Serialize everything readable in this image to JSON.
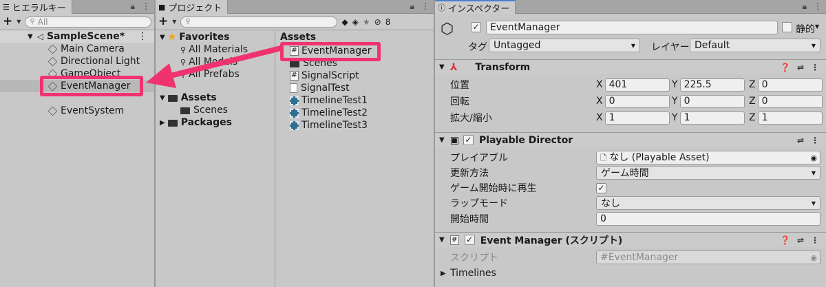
{
  "hierarchy": {
    "tab_label": "ヒエラルキー",
    "search_placeholder": "All",
    "scene": "SampleScene*",
    "items": [
      "Main Camera",
      "Directional Light",
      "GameObject",
      "EventManager",
      "EventSystem"
    ]
  },
  "project": {
    "tab_label": "プロジェクト",
    "hidden_count": "8",
    "favorites": {
      "label": "Favorites",
      "items": [
        "All Materials",
        "All Models",
        "All Prefabs"
      ]
    },
    "tree": {
      "assets": "Assets",
      "scenes": "Scenes",
      "packages": "Packages"
    },
    "assets_header": "Assets",
    "assets_items": [
      "EventManager",
      "Scenes",
      "SignalScript",
      "SignalTest",
      "TimelineTest1",
      "TimelineTest2",
      "TimelineTest3"
    ]
  },
  "inspector": {
    "tab_label": "インスペクター",
    "object_name": "EventManager",
    "static_label": "静的",
    "tag_label": "タグ",
    "tag_value": "Untagged",
    "layer_label": "レイヤー",
    "layer_value": "Default",
    "transform": {
      "title": "Transform",
      "position_label": "位置",
      "position": [
        "401",
        "225.5",
        "0"
      ],
      "rotation_label": "回転",
      "rotation": [
        "0",
        "0",
        "0"
      ],
      "scale_label": "拡大/縮小",
      "scale": [
        "1",
        "1",
        "1"
      ],
      "axes": [
        "X",
        "Y",
        "Z"
      ]
    },
    "director": {
      "title": "Playable Director",
      "playable_label": "プレイアブル",
      "playable_value": "なし (Playable Asset)",
      "update_label": "更新方法",
      "update_value": "ゲーム時間",
      "play_on_awake_label": "ゲーム開始時に再生",
      "wrap_label": "ラップモード",
      "wrap_value": "なし",
      "initial_time_label": "開始時間",
      "initial_time_value": "0"
    },
    "event_manager": {
      "title": "Event Manager (スクリプト)",
      "script_label": "スクリプト",
      "script_value": "EventManager",
      "timelines_label": "Timelines"
    }
  },
  "colors": {
    "highlight": "#f0336f"
  }
}
